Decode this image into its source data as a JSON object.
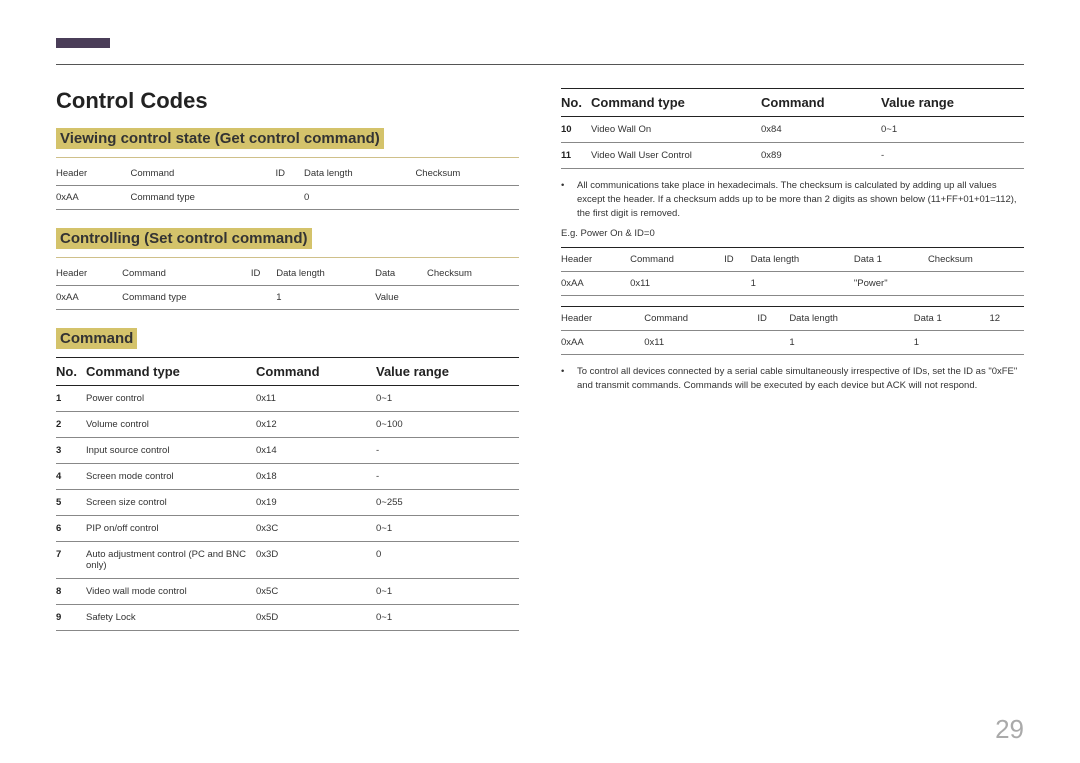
{
  "page_number": "29",
  "title": "Control Codes",
  "left": {
    "h2_view": "Viewing control state (Get control command)",
    "view_table": {
      "headers": [
        "Header",
        "Command",
        "ID",
        "Data length",
        "Checksum"
      ],
      "row": [
        "0xAA",
        "Command type",
        "",
        "0",
        ""
      ]
    },
    "h2_set": "Controlling (Set control command)",
    "set_table": {
      "headers": [
        "Header",
        "Command",
        "ID",
        "Data length",
        "Data",
        "Checksum"
      ],
      "row": [
        "0xAA",
        "Command type",
        "",
        "1",
        "Value",
        ""
      ]
    },
    "h2_cmd": "Command",
    "cmd_head": {
      "no": "No.",
      "type": "Command type",
      "cmd": "Command",
      "range": "Value range"
    },
    "cmds": [
      {
        "no": "1",
        "type": "Power control",
        "cmd": "0x11",
        "range": "0~1"
      },
      {
        "no": "2",
        "type": "Volume control",
        "cmd": "0x12",
        "range": "0~100"
      },
      {
        "no": "3",
        "type": "Input source control",
        "cmd": "0x14",
        "range": "-"
      },
      {
        "no": "4",
        "type": "Screen mode control",
        "cmd": "0x18",
        "range": "-"
      },
      {
        "no": "5",
        "type": "Screen size control",
        "cmd": "0x19",
        "range": "0~255"
      },
      {
        "no": "6",
        "type": "PIP on/off control",
        "cmd": "0x3C",
        "range": "0~1"
      },
      {
        "no": "7",
        "type": "Auto adjustment control (PC and BNC only)",
        "cmd": "0x3D",
        "range": "0"
      },
      {
        "no": "8",
        "type": "Video wall mode control",
        "cmd": "0x5C",
        "range": "0~1"
      },
      {
        "no": "9",
        "type": "Safety Lock",
        "cmd": "0x5D",
        "range": "0~1"
      }
    ]
  },
  "right": {
    "cmd_head": {
      "no": "No.",
      "type": "Command type",
      "cmd": "Command",
      "range": "Value range"
    },
    "cmds": [
      {
        "no": "10",
        "type": "Video Wall On",
        "cmd": "0x84",
        "range": "0~1"
      },
      {
        "no": "11",
        "type": "Video Wall User Control",
        "cmd": "0x89",
        "range": "-"
      }
    ],
    "note1": "All communications take place in hexadecimals. The checksum is calculated by adding up all values except the header. If a checksum adds up to be more than 2 digits as shown below (11+FF+01+01=112), the first digit is removed.",
    "eg_label": "E.g. Power On & ID=0",
    "ex_table_head": [
      "Header",
      "Command",
      "ID",
      "Data length",
      "Data 1",
      "Checksum"
    ],
    "ex1_row": [
      "0xAA",
      "0x11",
      "",
      "1",
      "\"Power\"",
      ""
    ],
    "ex2_head": [
      "Header",
      "Command",
      "ID",
      "Data length",
      "Data 1",
      "12"
    ],
    "ex2_row": [
      "0xAA",
      "0x11",
      "",
      "1",
      "1",
      ""
    ],
    "note2": "To control all devices connected by a serial cable simultaneously irrespective of IDs, set the ID as \"0xFE\" and transmit commands. Commands will be executed by each device but ACK will not respond."
  }
}
